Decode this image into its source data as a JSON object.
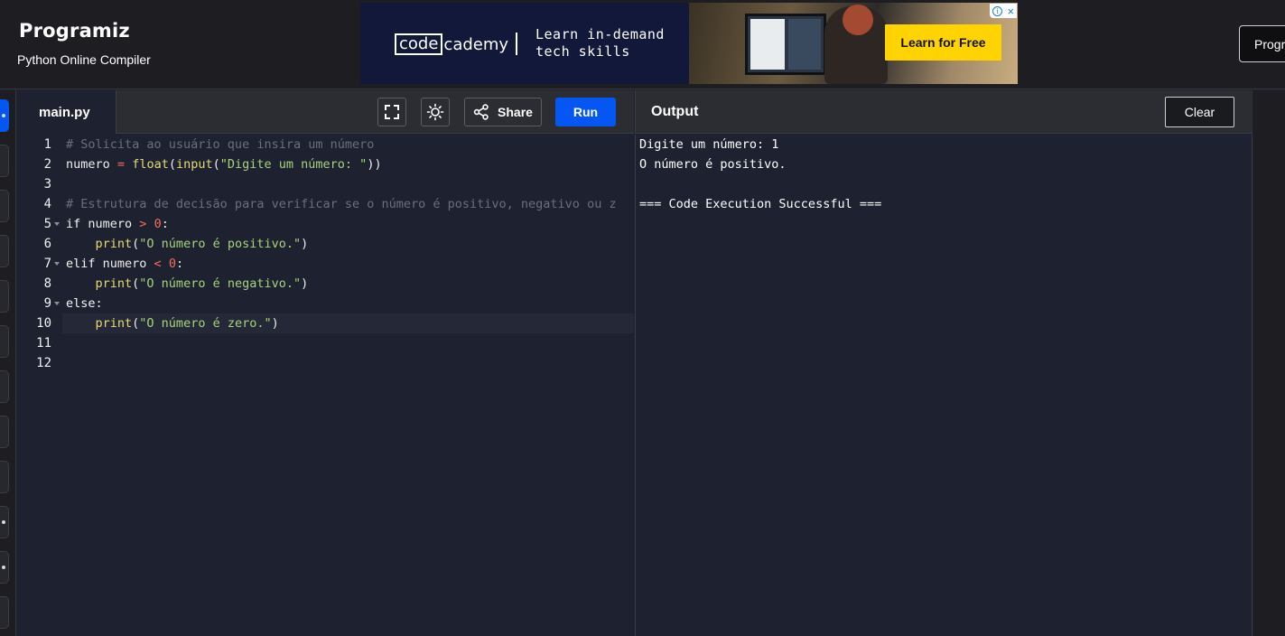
{
  "header": {
    "logo": "Programiz",
    "subtitle": "Python Online Compiler",
    "programiz_button": "Progr"
  },
  "ad": {
    "brand_boxed": "code",
    "brand_rest": "cademy",
    "tagline_line1": "Learn in-demand",
    "tagline_line2": "tech skills",
    "cta": "Learn for Free",
    "choices_icon": "i",
    "close_icon": "×"
  },
  "editor": {
    "file_tab": "main.py",
    "share_label": "Share",
    "run_label": "Run",
    "lines": [
      {
        "num": "1",
        "fold": false,
        "tokens": [
          {
            "t": "comment",
            "v": "# Solicita ao usuário que insira um número"
          }
        ]
      },
      {
        "num": "2",
        "fold": false,
        "tokens": [
          {
            "t": "plain",
            "v": "numero "
          },
          {
            "t": "op",
            "v": "="
          },
          {
            "t": "plain",
            "v": " "
          },
          {
            "t": "func",
            "v": "float"
          },
          {
            "t": "plain",
            "v": "("
          },
          {
            "t": "func",
            "v": "input"
          },
          {
            "t": "plain",
            "v": "("
          },
          {
            "t": "string",
            "v": "\"Digite um número: \""
          },
          {
            "t": "plain",
            "v": "))"
          }
        ]
      },
      {
        "num": "3",
        "fold": false,
        "tokens": []
      },
      {
        "num": "4",
        "fold": false,
        "tokens": [
          {
            "t": "comment",
            "v": "# Estrutura de decisão para verificar se o número é positivo, negativo ou z"
          }
        ]
      },
      {
        "num": "5",
        "fold": true,
        "tokens": [
          {
            "t": "keyword",
            "v": "if"
          },
          {
            "t": "plain",
            "v": " numero "
          },
          {
            "t": "op",
            "v": ">"
          },
          {
            "t": "plain",
            "v": " "
          },
          {
            "t": "number",
            "v": "0"
          },
          {
            "t": "plain",
            "v": ":"
          }
        ]
      },
      {
        "num": "6",
        "fold": false,
        "tokens": [
          {
            "t": "plain",
            "v": "    "
          },
          {
            "t": "func",
            "v": "print"
          },
          {
            "t": "plain",
            "v": "("
          },
          {
            "t": "string",
            "v": "\"O número é positivo.\""
          },
          {
            "t": "plain",
            "v": ")"
          }
        ]
      },
      {
        "num": "7",
        "fold": true,
        "tokens": [
          {
            "t": "keyword",
            "v": "elif"
          },
          {
            "t": "plain",
            "v": " numero "
          },
          {
            "t": "op",
            "v": "<"
          },
          {
            "t": "plain",
            "v": " "
          },
          {
            "t": "number",
            "v": "0"
          },
          {
            "t": "plain",
            "v": ":"
          }
        ]
      },
      {
        "num": "8",
        "fold": false,
        "tokens": [
          {
            "t": "plain",
            "v": "    "
          },
          {
            "t": "func",
            "v": "print"
          },
          {
            "t": "plain",
            "v": "("
          },
          {
            "t": "string",
            "v": "\"O número é negativo.\""
          },
          {
            "t": "plain",
            "v": ")"
          }
        ]
      },
      {
        "num": "9",
        "fold": true,
        "tokens": [
          {
            "t": "keyword",
            "v": "else"
          },
          {
            "t": "plain",
            "v": ":"
          }
        ]
      },
      {
        "num": "10",
        "fold": false,
        "active": true,
        "tokens": [
          {
            "t": "plain",
            "v": "    "
          },
          {
            "t": "func",
            "v": "print"
          },
          {
            "t": "plain",
            "v": "("
          },
          {
            "t": "string",
            "v": "\"O número é zero.\""
          },
          {
            "t": "plain",
            "v": ")"
          }
        ]
      },
      {
        "num": "11",
        "fold": false,
        "tokens": []
      },
      {
        "num": "12",
        "fold": false,
        "tokens": []
      }
    ]
  },
  "output": {
    "title": "Output",
    "clear_label": "Clear",
    "lines": [
      "Digite um número: 1",
      "O número é positivo.",
      "",
      "=== Code Execution Successful ==="
    ]
  },
  "colors": {
    "run_button": "#0556f3",
    "ad_cta": "#ffd300",
    "editor_bg": "#1e2230"
  }
}
